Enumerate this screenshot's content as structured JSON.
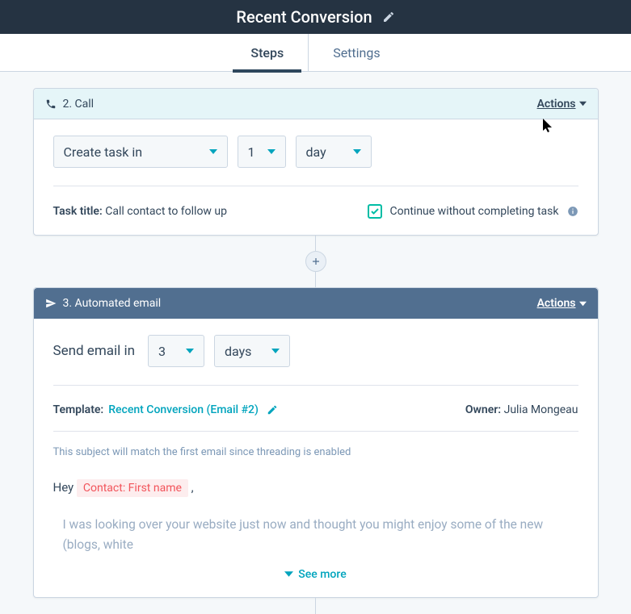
{
  "header": {
    "title": "Recent Conversion"
  },
  "tabs": {
    "steps": "Steps",
    "settings": "Settings"
  },
  "step2": {
    "title": "2. Call",
    "actions": "Actions",
    "createTask": "Create task in",
    "qty": "1",
    "unit": "day",
    "taskTitleLabel": "Task title:",
    "taskTitleValue": "Call contact to follow up",
    "continueLabel": "Continue without completing task"
  },
  "step3": {
    "title": "3. Automated email",
    "actions": "Actions",
    "sendLabel": "Send email in",
    "qty": "3",
    "unit": "days",
    "templateLabel": "Template:",
    "templateName": "Recent Conversion (Email #2)",
    "ownerLabel": "Owner:",
    "ownerName": "Julia Mongeau",
    "threadNote": "This subject will match the first email since threading is enabled",
    "greeting": "Hey ",
    "token": "Contact: First name",
    "comma": " ,",
    "body": "I was looking over your website just now and thought you might enjoy some of the new (blogs, white",
    "seeMore": "See more"
  }
}
